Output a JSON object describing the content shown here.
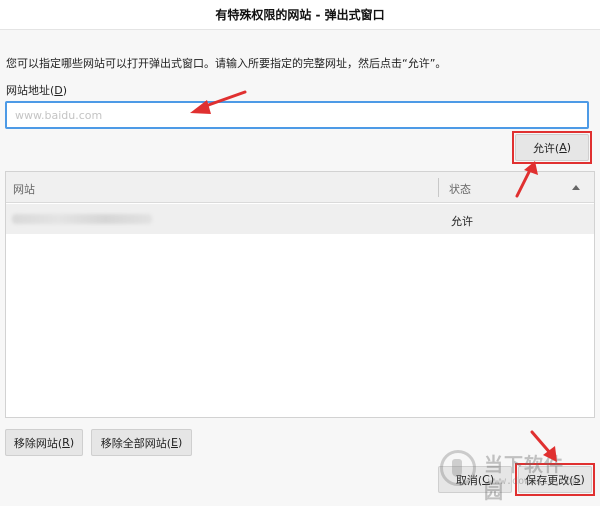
{
  "window": {
    "title": "有特殊权限的网站 - 弹出式窗口"
  },
  "description": "您可以指定哪些网站可以打开弹出式窗口。请输入所要指定的完整网址，然后点击“允许”。",
  "url_field": {
    "label": "网站地址(",
    "accesskey": "D",
    "label_end": ")",
    "placeholder": "www.baidu.com",
    "value": ""
  },
  "allow_button": {
    "label": "允许(",
    "accesskey": "A",
    "end": ")"
  },
  "table": {
    "columns": [
      {
        "label": "网站"
      },
      {
        "label": "状态"
      }
    ],
    "rows": [
      {
        "status": "允许"
      }
    ]
  },
  "footer": {
    "remove_site": {
      "label": "移除网站(",
      "accesskey": "R",
      "end": ")"
    },
    "remove_all": {
      "label": "移除全部网站(",
      "accesskey": "E",
      "end": ")"
    },
    "cancel": {
      "label": "取消(",
      "accesskey": "C",
      "end": ")"
    },
    "save": {
      "label": "保存更改(",
      "accesskey": "S",
      "end": ")"
    }
  },
  "watermark": {
    "text": "当下软件园",
    "sub": "www.downxia.com"
  },
  "colors": {
    "highlight": "#e03030",
    "focus_border": "#4d9ae6",
    "arrow": "#e03030"
  }
}
